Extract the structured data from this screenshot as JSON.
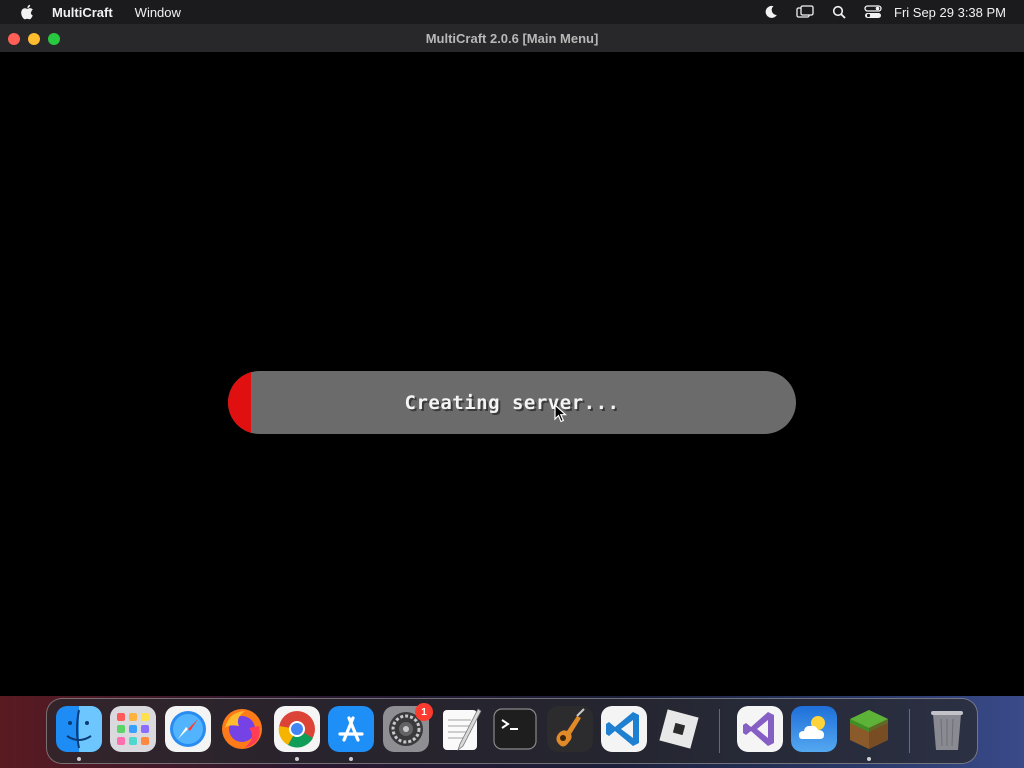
{
  "menubar": {
    "app_name": "MultiCraft",
    "menus": [
      "Window"
    ],
    "clock": "Fri Sep 29  3:38 PM",
    "status_icons": [
      "moon-icon",
      "screen-mirroring-icon",
      "spotlight-search-icon",
      "control-center-icon"
    ]
  },
  "window": {
    "title": "MultiCraft 2.0.6 [Main Menu]"
  },
  "loading": {
    "label": "Creating server...",
    "progress": 0.04,
    "fill_color": "#e01010",
    "track_color": "#6b6b6b"
  },
  "dock": {
    "apps": [
      {
        "name": "Finder",
        "icon": "finder-icon",
        "running": true
      },
      {
        "name": "Launchpad",
        "icon": "launchpad-icon",
        "running": false
      },
      {
        "name": "Safari",
        "icon": "safari-icon",
        "running": false
      },
      {
        "name": "Firefox",
        "icon": "firefox-icon",
        "running": false
      },
      {
        "name": "Google Chrome",
        "icon": "chrome-icon",
        "running": true
      },
      {
        "name": "App Store",
        "icon": "app-store-icon",
        "running": true
      },
      {
        "name": "System Settings",
        "icon": "system-settings-icon",
        "running": false,
        "badge": "1"
      },
      {
        "name": "TextEdit",
        "icon": "textedit-icon",
        "running": false
      },
      {
        "name": "Terminal",
        "icon": "terminal-icon",
        "running": false
      },
      {
        "name": "GarageBand",
        "icon": "garageband-icon",
        "running": false
      },
      {
        "name": "Visual Studio Code",
        "icon": "vscode-icon",
        "running": false
      },
      {
        "name": "Roblox",
        "icon": "roblox-icon",
        "running": false
      },
      {
        "name": "Visual Studio",
        "icon": "visual-studio-icon",
        "running": false
      },
      {
        "name": "Weather",
        "icon": "weather-icon",
        "running": false
      },
      {
        "name": "MultiCraft",
        "icon": "multicraft-icon",
        "running": true
      },
      {
        "name": "Trash",
        "icon": "trash-icon",
        "running": false
      }
    ],
    "badge_text": "1"
  }
}
